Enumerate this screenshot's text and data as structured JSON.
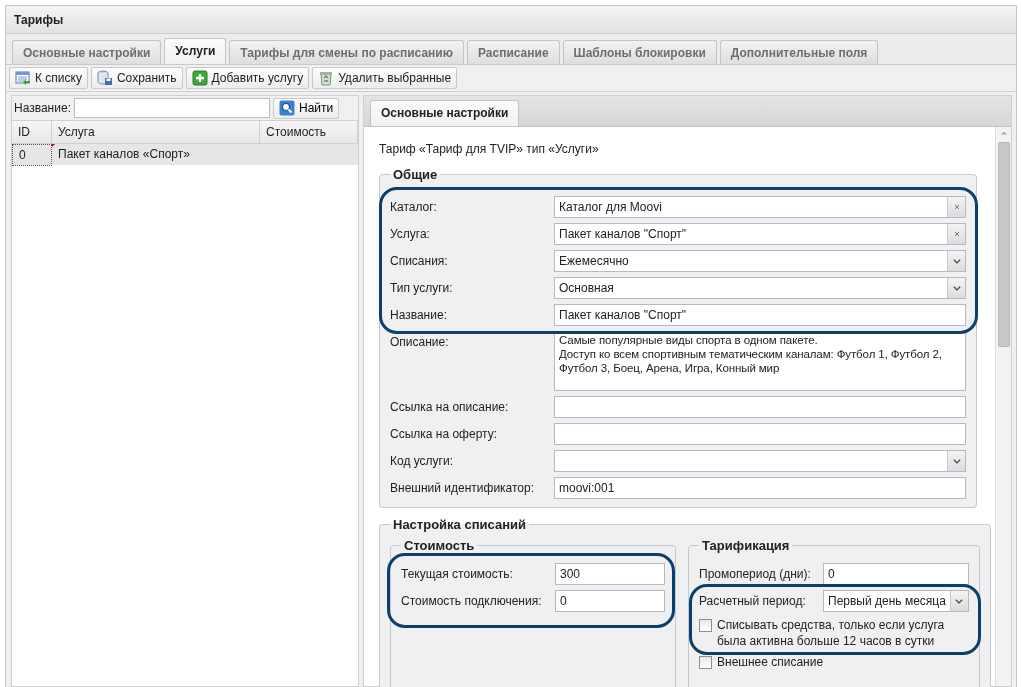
{
  "window": {
    "title": "Тарифы"
  },
  "tabs": [
    {
      "label": "Основные настройки",
      "selected": false
    },
    {
      "label": "Услуги",
      "selected": true
    },
    {
      "label": "Тарифы для смены по расписанию",
      "selected": false
    },
    {
      "label": "Расписание",
      "selected": false
    },
    {
      "label": "Шаблоны блокировки",
      "selected": false
    },
    {
      "label": "Дополнительные поля",
      "selected": false
    }
  ],
  "toolbar": [
    {
      "label": "К списку",
      "kind": "list"
    },
    {
      "label": "Сохранить",
      "kind": "save"
    },
    {
      "label": "Добавить услугу",
      "kind": "add"
    },
    {
      "label": "Удалить выбранные",
      "kind": "recycle"
    }
  ],
  "search": {
    "label": "Название:",
    "button": "Найти"
  },
  "grid": {
    "columns": [
      "ID",
      "Услуга",
      "Стоимость"
    ],
    "rows": [
      {
        "cells": [
          "0",
          "Пакет каналов «Спорт»"
        ],
        "selected": true,
        "modified": true
      }
    ]
  },
  "detail": {
    "tabs": [
      {
        "label": "Основные настройки",
        "selected": true
      }
    ],
    "caption": "Тариф «Тариф для TVIP» тип «Услуги»",
    "general": {
      "title": "Общие",
      "fields": [
        {
          "kind": "outline",
          "fields": [
            {
              "label": "Каталог:",
              "kind": "clearable",
              "value": "Каталог для Moovi"
            },
            {
              "label": "Услуга:",
              "kind": "clearable",
              "value": "Пакет каналов \"Спорт\""
            },
            {
              "label": "Списания:",
              "kind": "select",
              "value": "Ежемесячно"
            },
            {
              "label": "Тип услуги:",
              "kind": "select",
              "value": "Основная"
            },
            {
              "label": "Название:",
              "kind": "text",
              "value": "Пакет каналов \"Спорт\""
            }
          ]
        },
        {
          "label": "Описание:",
          "kind": "textarea",
          "value": "Самые популярные виды спорта в одном пакете.\nДоступ ко всем спортивным тематическим каналам: Футбол 1, Футбол 2, Футбол 3, Боец, Арена, Игра, Конный мир"
        },
        {
          "label": "Ссылка на описание:",
          "kind": "text"
        },
        {
          "label": "Ссылка на оферту:",
          "kind": "text"
        },
        {
          "label": "Код услуги:",
          "kind": "select"
        },
        {
          "label": "Внешний идентификатор:",
          "kind": "text",
          "value": "moovi:001"
        }
      ]
    },
    "charges": {
      "title": "Настройка списаний",
      "cost": {
        "title": "Стоимость",
        "fields": [
          {
            "kind": "outline",
            "fields": [
              {
                "label": "Текущая стоимость:",
                "kind": "text",
                "value": "300"
              },
              {
                "label": "Стоимость подключения:",
                "kind": "text",
                "value": "0"
              }
            ]
          }
        ]
      },
      "billing": {
        "title": "Тарификация",
        "fields": [
          {
            "label": "Промопериод (дни):",
            "kind": "text",
            "value": "0"
          },
          {
            "kind": "outline",
            "fields": [
              {
                "label": "Расчетный период:",
                "kind": "select",
                "value": "Первый день месяца"
              },
              {
                "label": "Списывать средства, только если услуга была активна больше 12 часов в сутки",
                "kind": "checkbox",
                "checked": false
              }
            ]
          },
          {
            "label": "Внешнее списание",
            "kind": "checkbox",
            "checked": false
          }
        ]
      }
    }
  }
}
